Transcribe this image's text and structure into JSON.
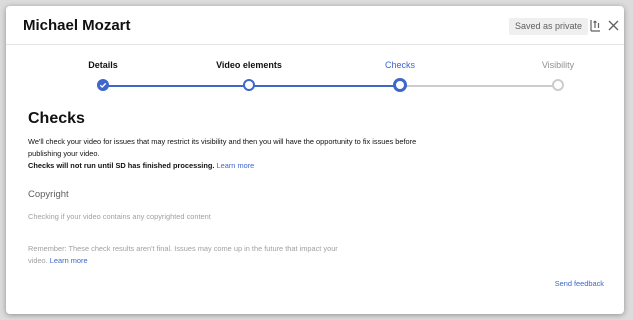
{
  "header": {
    "channel_name": "Michael Mozart",
    "saved_status": "Saved as private"
  },
  "stepper": {
    "steps": [
      {
        "label": "Details",
        "state": "completed"
      },
      {
        "label": "Video elements",
        "state": "completed"
      },
      {
        "label": "Checks",
        "state": "current"
      },
      {
        "label": "Visibility",
        "state": "upcoming"
      }
    ]
  },
  "main": {
    "title": "Checks",
    "intro": "We'll check your video for issues that may restrict its visibility and then you will have the opportunity to fix issues before publishing your video.",
    "processing_note": "Checks will not run until SD has finished processing.",
    "processing_link": "Learn more",
    "copyright_title": "Copyright",
    "copyright_status": "Checking if your video contains any copyrighted content",
    "reminder": "Remember: These check results aren't final. Issues may come up in the future that impact your video.",
    "reminder_link": "Learn more",
    "feedback_link": "Send feedback"
  },
  "colors": {
    "accent": "#3e67c9",
    "inactive": "#cccccc"
  }
}
